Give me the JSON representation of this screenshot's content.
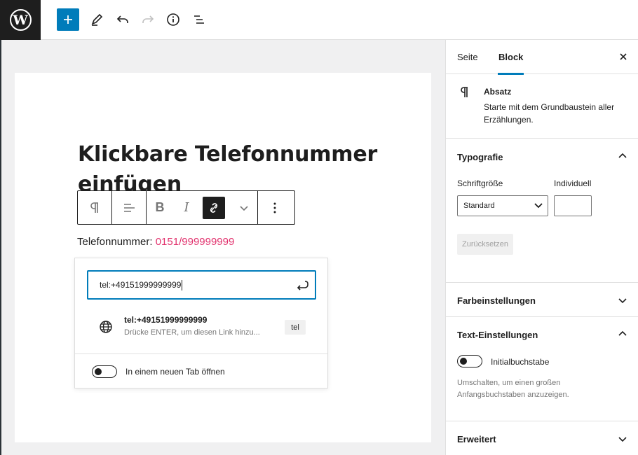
{
  "topbar": {
    "logo_icon": "wordpress-logo-icon",
    "logo_letter": "W",
    "add_icon": "plus-icon",
    "tools_icon": "pencil-icon",
    "undo_icon": "undo-icon",
    "redo_icon": "redo-icon",
    "info_icon": "info-icon",
    "outline_icon": "list-view-icon",
    "accent_color": "#007cba"
  },
  "editor": {
    "title": "Klickbare Telefonnummer einfügen",
    "paragraph_prefix": "Telefonnummer: ",
    "paragraph_link": "0151/999999999",
    "link_color": "#e1306c"
  },
  "block_toolbar": {
    "paragraph_icon": "pilcrow-icon",
    "align_icon": "align-left-icon",
    "bold_label": "B",
    "italic_label": "I",
    "unlink_icon": "link-off-icon",
    "more_rich_icon": "chevron-down-icon",
    "options_icon": "more-vertical-icon"
  },
  "link_popover": {
    "url_value": "tel:+49151999999999",
    "submit_icon": "enter-icon",
    "suggestion": {
      "icon": "globe-icon",
      "title": "tel:+49151999999999",
      "subtitle": "Drücke ENTER, um diesen Link hinzu...",
      "tag": "tel"
    },
    "new_tab_label": "In einem neuen Tab öffnen"
  },
  "sidebar": {
    "tabs": [
      {
        "label": "Seite",
        "active": false
      },
      {
        "label": "Block",
        "active": true
      }
    ],
    "close_icon": "close-icon",
    "block_card": {
      "icon": "pilcrow-icon",
      "name": "Absatz",
      "description": "Starte mit dem Grundbaustein aller Erzählungen."
    },
    "typography": {
      "title": "Typografie",
      "font_size_label": "Schriftgröße",
      "custom_label": "Individuell",
      "select_value": "Standard",
      "reset_label": "Zurücksetzen"
    },
    "color_settings": {
      "title": "Farbeinstellungen"
    },
    "text_settings": {
      "title": "Text-Einstellungen",
      "dropcap_label": "Initialbuchstabe",
      "help": "Umschalten, um einen großen Anfangsbuchstaben anzuzeigen."
    },
    "advanced": {
      "title": "Erweitert"
    }
  }
}
